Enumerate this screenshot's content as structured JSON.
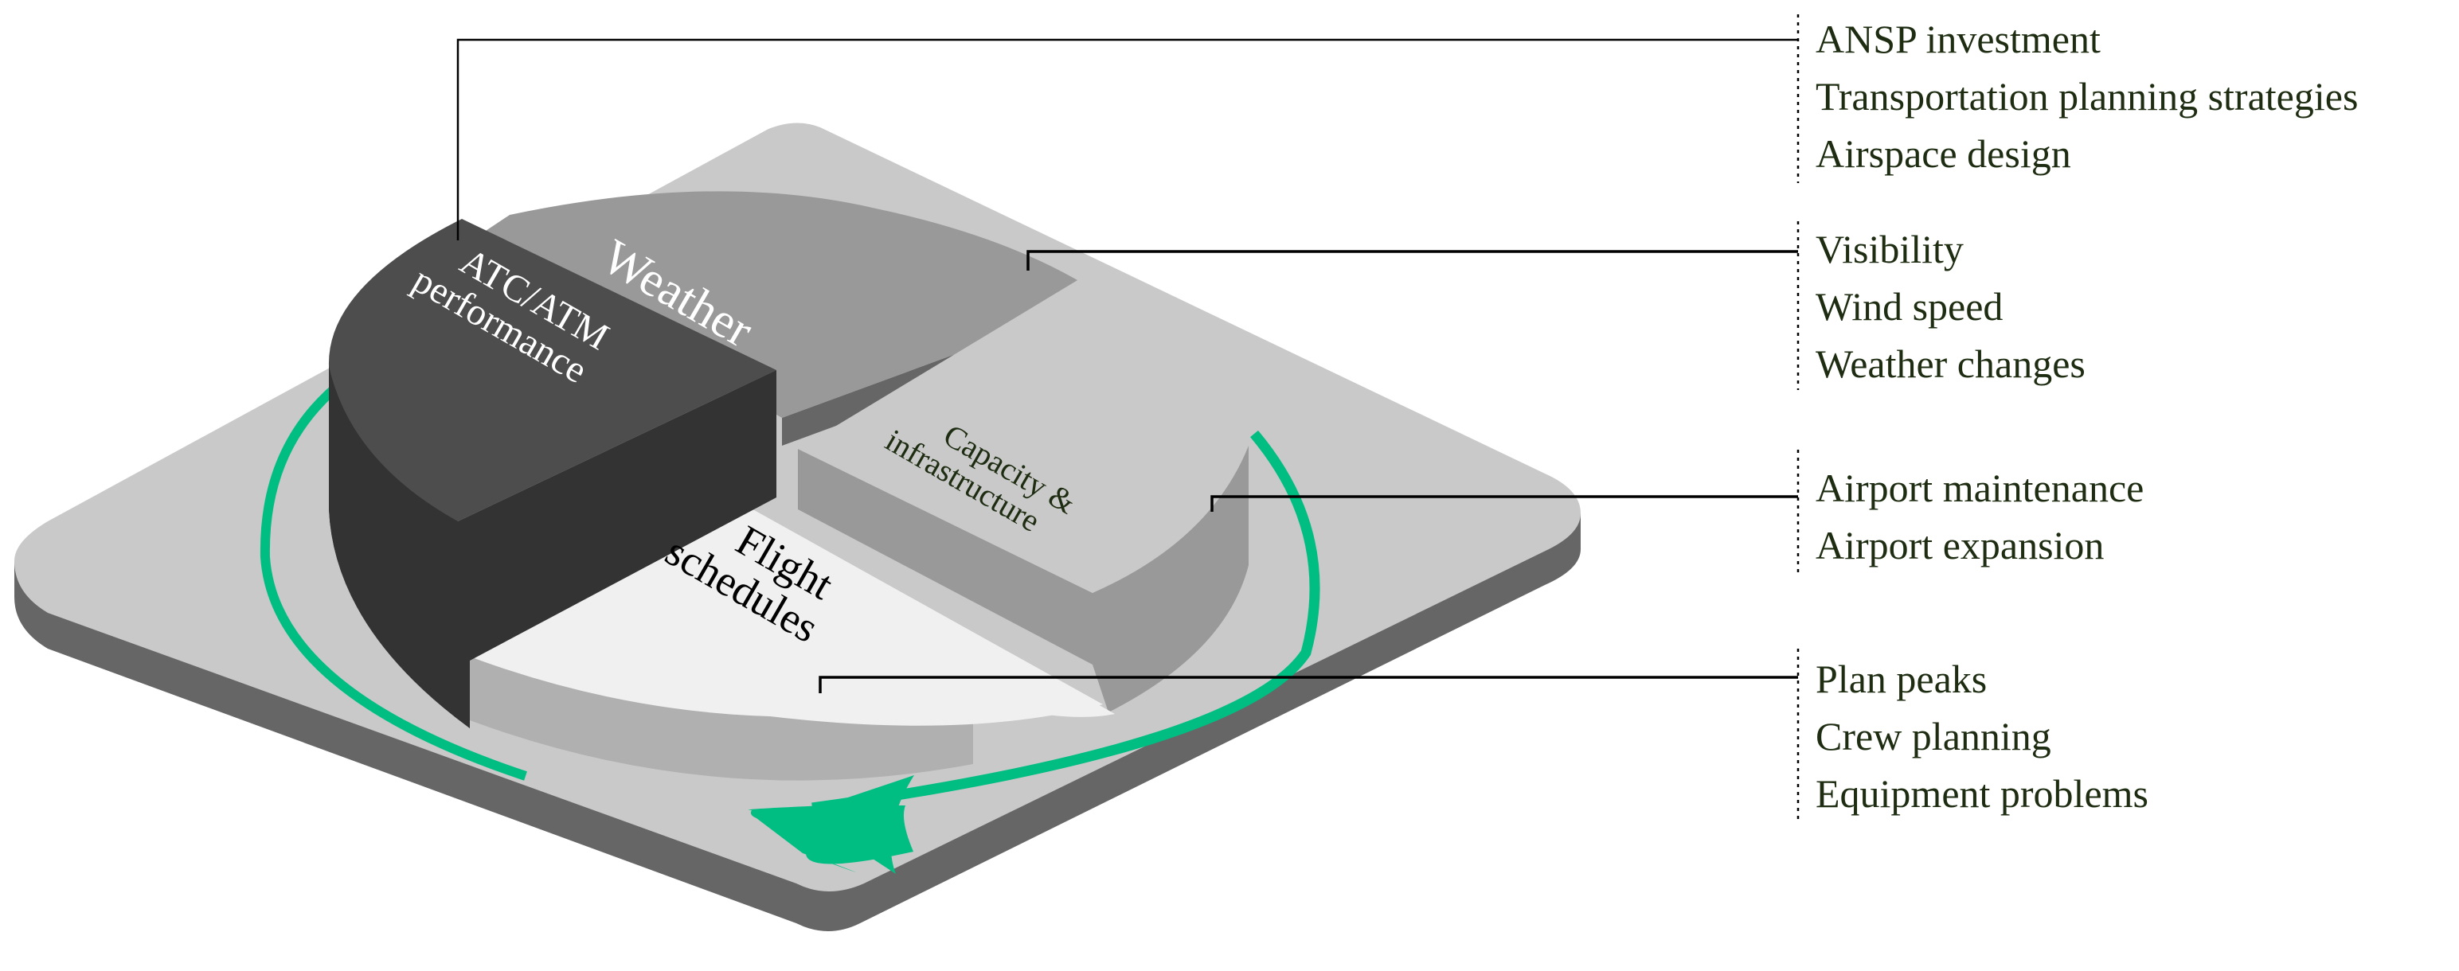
{
  "diagram": {
    "type": "isometric-pie-factors",
    "segments": [
      {
        "id": "atc",
        "label_lines": [
          "ATC/ATM",
          "performance"
        ],
        "color_top": "#4d4d4d",
        "color_side": "#333333",
        "text_color": "#ffffff"
      },
      {
        "id": "weather",
        "label_lines": [
          "Weather"
        ],
        "color_top": "#999999",
        "color_side": "#666666",
        "text_color": "#ffffff"
      },
      {
        "id": "capacity",
        "label_lines": [
          "Capacity &",
          "infrastructure"
        ],
        "color_top": "#c9c9c9",
        "color_side": "#999999",
        "text_color": "#1e2d12"
      },
      {
        "id": "flight",
        "label_lines": [
          "Flight",
          "schedules"
        ],
        "color_top": "#f0f0f0",
        "color_side": "#b0b0b0",
        "text_color": "#000000"
      }
    ],
    "callouts": [
      {
        "segment": "atc",
        "items": [
          "ANSP investment",
          "Transportation planning strategies",
          "Airspace design"
        ]
      },
      {
        "segment": "weather",
        "items": [
          "Visibility",
          "Wind speed",
          "Weather changes"
        ]
      },
      {
        "segment": "capacity",
        "items": [
          "Airport maintenance",
          "Airport expansion"
        ]
      },
      {
        "segment": "flight",
        "items": [
          "Plan peaks",
          "Crew planning",
          "Equipment problems"
        ]
      }
    ],
    "colors": {
      "base_top": "#c9c9c9",
      "base_side": "#666666",
      "arrow": "#00be82",
      "legend_text": "#1e2d12"
    },
    "cycle_arrow": {
      "direction": "counterclockwise",
      "icon": "cycle-arrow-icon"
    }
  }
}
